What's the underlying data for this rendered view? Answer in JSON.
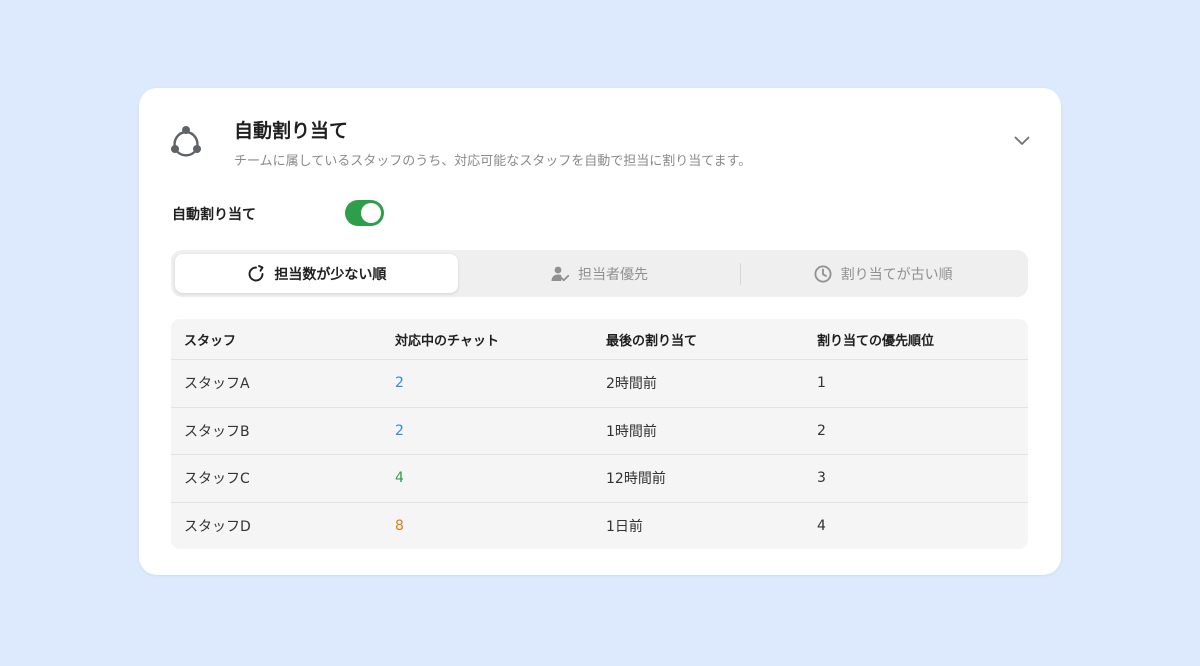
{
  "header": {
    "title": "自動割り当て",
    "subtitle": "チームに属しているスタッフのうち、対応可能なスタッフを自動で担当に割り当てます。",
    "icon": "share-nodes-icon",
    "collapse_icon": "chevron-down-icon"
  },
  "toggle": {
    "label": "自動割り当て",
    "on": true,
    "color": "#2e9e4b"
  },
  "tabs": [
    {
      "label": "担当数が少ない順",
      "icon": "refresh-arrow-icon",
      "active": true
    },
    {
      "label": "担当者優先",
      "icon": "user-check-icon",
      "active": false
    },
    {
      "label": "割り当てが古い順",
      "icon": "clock-icon",
      "active": false
    }
  ],
  "table": {
    "columns": [
      "スタッフ",
      "対応中のチャット",
      "最後の割り当て",
      "割り当ての優先順位"
    ],
    "rows": [
      {
        "staff": "スタッフA",
        "chats": "2",
        "chats_color": "#2a8fd6",
        "last": "2時間前",
        "priority": "1"
      },
      {
        "staff": "スタッフB",
        "chats": "2",
        "chats_color": "#2a8fd6",
        "last": "1時間前",
        "priority": "2"
      },
      {
        "staff": "スタッフC",
        "chats": "4",
        "chats_color": "#2e9e4b",
        "last": "12時間前",
        "priority": "3"
      },
      {
        "staff": "スタッフD",
        "chats": "8",
        "chats_color": "#e07b1a",
        "last": "1日前",
        "priority": "4"
      }
    ]
  }
}
